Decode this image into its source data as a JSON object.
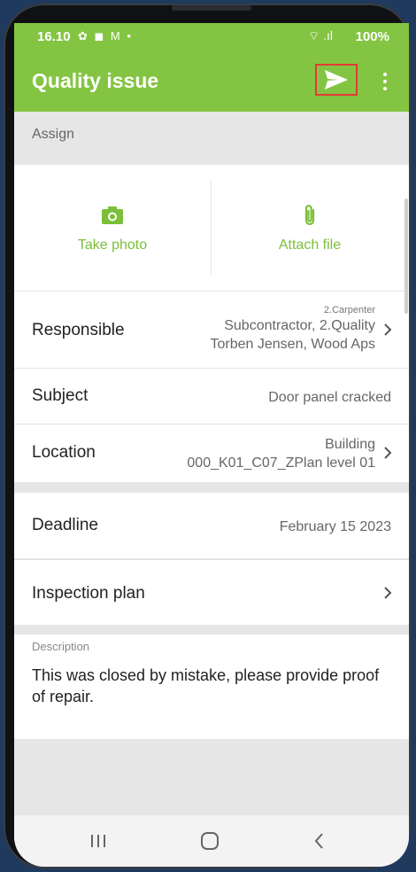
{
  "status_bar": {
    "time": "16.10",
    "icons": "✿ ◼ M •",
    "network": "⌔ .ıl",
    "battery": "100%"
  },
  "app_bar": {
    "title": "Quality issue",
    "send_icon": "send-icon",
    "more_icon": "more-vert-icon",
    "accent_color": "#84c443"
  },
  "section": {
    "assign_label": "Assign"
  },
  "actions": {
    "take_photo_label": "Take photo",
    "attach_file_label": "Attach file"
  },
  "fields": {
    "responsible": {
      "label": "Responsible",
      "line1": "2.Carpenter",
      "line2": "Subcontractor, 2.Quality",
      "line3": "Torben Jensen, Wood Aps"
    },
    "subject": {
      "label": "Subject",
      "value": "Door panel cracked"
    },
    "location": {
      "label": "Location",
      "line1": "Building",
      "line2": "000_K01_C07_ZPlan level 01"
    },
    "deadline": {
      "label": "Deadline",
      "value": "February 15 2023"
    },
    "inspection_plan": {
      "label": "Inspection plan"
    }
  },
  "description": {
    "label": "Description",
    "text": "This was closed by mistake, please provide proof of repair."
  }
}
